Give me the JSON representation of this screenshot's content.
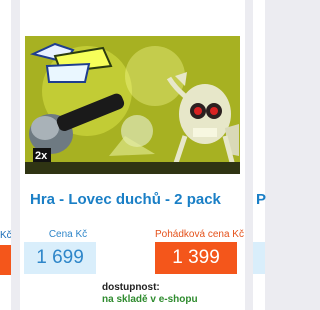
{
  "left_card": {
    "cut_label": "Kč"
  },
  "product": {
    "title": "Hra - Lovec duchů - 2 pack",
    "price_label": "Cena Kč",
    "price": "1 699",
    "fairy_price_label": "Pohádková cena Kč",
    "fairy_price": "1 399",
    "availability_label": "dostupnost:",
    "availability_value": "na skladě v e-shopu",
    "image_alt": "Lovec duchů box art"
  },
  "right_card": {
    "cut_title": "P"
  },
  "colors": {
    "title_blue": "#1a7fc6",
    "price_blue": "#2e86c9",
    "price_bg": "#d9eefb",
    "fairy_orange": "#f4561b",
    "stock_green": "#2e8b2e"
  }
}
